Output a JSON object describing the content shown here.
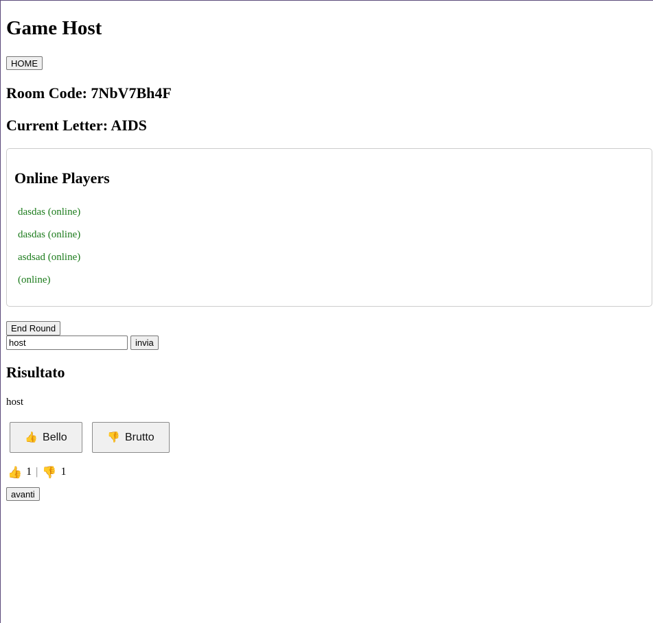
{
  "header": {
    "title": "Game Host",
    "home_label": "HOME"
  },
  "room": {
    "code_label": "Room Code: 7NbV7Bh4F",
    "letter_label": "Current Letter: AIDS"
  },
  "players": {
    "title": "Online Players",
    "items": [
      "dasdas (online)",
      "dasdas (online)",
      "asdsad (online)",
      "(online)"
    ]
  },
  "controls": {
    "end_round_label": "End Round",
    "answer_value": "host",
    "send_label": "invia"
  },
  "result": {
    "title": "Risultato",
    "text": "host",
    "like_label": "Bello",
    "dislike_label": "Brutto",
    "like_count": "1",
    "separator": "|",
    "dislike_count": "1",
    "next_label": "avanti"
  },
  "icons": {
    "like": "thumbs-up-icon",
    "dislike": "thumbs-down-icon"
  },
  "colors": {
    "online_text": "#1a7a1a",
    "emoji": "#f2b31b"
  }
}
